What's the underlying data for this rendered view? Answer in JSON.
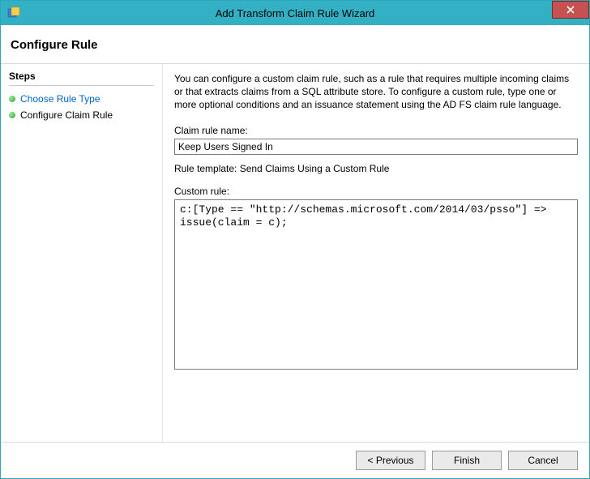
{
  "window": {
    "title": "Add Transform Claim Rule Wizard"
  },
  "header": {
    "title": "Configure Rule"
  },
  "sidebar": {
    "heading": "Steps",
    "items": [
      {
        "label": "Choose Rule Type",
        "current": false
      },
      {
        "label": "Configure Claim Rule",
        "current": true
      }
    ]
  },
  "main": {
    "description": "You can configure a custom claim rule, such as a rule that requires multiple incoming claims or that extracts claims from a SQL attribute store. To configure a custom rule, type one or more optional conditions and an issuance statement using the AD FS claim rule language.",
    "ruleNameLabel": "Claim rule name:",
    "ruleNameValue": "Keep Users Signed In",
    "templateLine": "Rule template: Send Claims Using a Custom Rule",
    "customRuleLabel": "Custom rule:",
    "customRuleValue": "c:[Type == \"http://schemas.microsoft.com/2014/03/psso\"] => issue(claim = c);"
  },
  "footer": {
    "previous": "< Previous",
    "finish": "Finish",
    "cancel": "Cancel"
  }
}
